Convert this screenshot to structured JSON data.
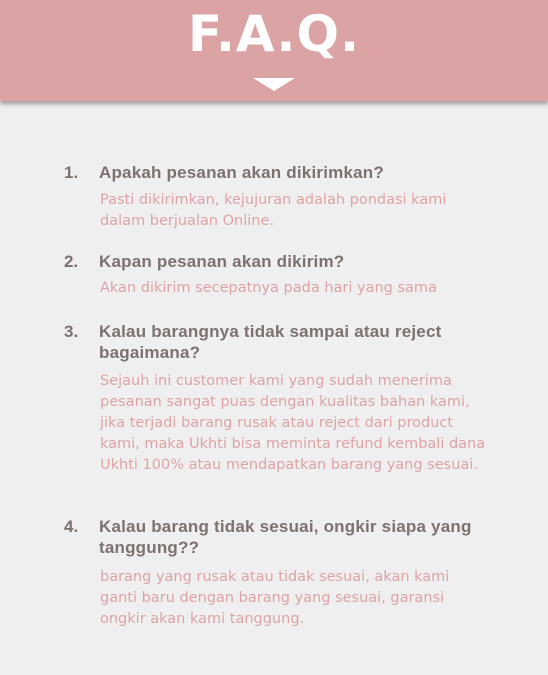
{
  "header": {
    "title": "F.A.Q."
  },
  "faq": [
    {
      "number": "1.",
      "question": "Apakah pesanan akan dikirimkan?",
      "answer": "Pasti dikirimkan, kejujuran adalah pondasi kami dalam berjualan Online."
    },
    {
      "number": "2.",
      "question": "Kapan pesanan akan dikirim?",
      "answer": "Akan dikirim secepatnya pada hari yang sama"
    },
    {
      "number": "3.",
      "question": "Kalau barangnya tidak sampai atau reject bagaimana?",
      "answer": "Sejauh ini customer kami yang sudah menerima pesanan sangat puas dengan kualitas bahan kami, jika terjadi barang rusak atau reject dari product kami, maka Ukhti bisa meminta refund kembali dana Ukhti 100% atau mendapatkan barang yang sesuai."
    },
    {
      "number": "4.",
      "question": "Kalau barang tidak sesuai, ongkir siapa yang tanggung??",
      "answer": "barang yang rusak atau tidak sesuai, akan kami ganti baru dengan barang yang sesuai, garansi ongkir akan kami tanggung."
    }
  ],
  "colors": {
    "header_bg": "#dba3a4",
    "page_bg": "#efefef",
    "question_text": "#7d7270",
    "answer_text": "#dea3a6",
    "title_text": "#ffffff"
  },
  "icons": {
    "header_arrow": "chevron-down-triangle-icon"
  }
}
